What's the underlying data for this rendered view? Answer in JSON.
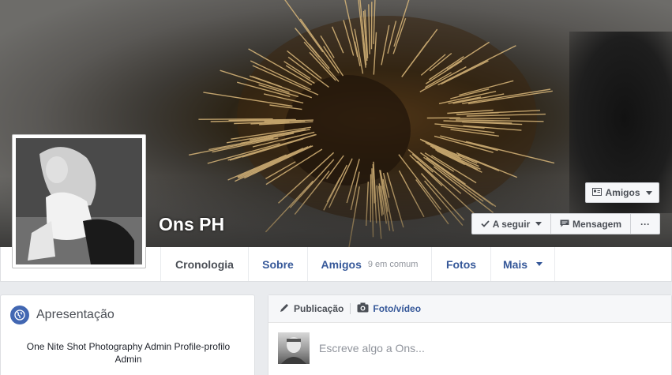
{
  "profile": {
    "name": "Ons PH"
  },
  "cover_actions": {
    "friends_label": "Amigos",
    "follow_label": "A seguir",
    "message_label": "Mensagem",
    "more_label": "···"
  },
  "tabs": [
    {
      "label": "Cronologia",
      "active": true
    },
    {
      "label": "Sobre"
    },
    {
      "label": "Amigos",
      "extra": "9 em comum"
    },
    {
      "label": "Fotos"
    },
    {
      "label": "Mais"
    }
  ],
  "intro": {
    "title": "Apresentação",
    "bio": "One Nite Shot Photography Admin Profile-profilo Admin"
  },
  "composer": {
    "tab_post": "Publicação",
    "tab_photo": "Foto/vídeo",
    "placeholder": "Escreve algo a Ons..."
  },
  "icons": {
    "friends": "friends-card-icon",
    "follow": "checkmark-icon",
    "message": "message-icon",
    "globe": "globe-icon",
    "pencil": "pencil-icon",
    "camera": "camera-icon"
  },
  "colors": {
    "link": "#365899",
    "accent": "#4267b2",
    "page_bg": "#e9ebee"
  }
}
